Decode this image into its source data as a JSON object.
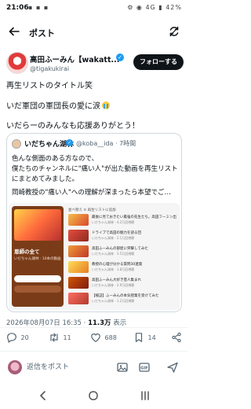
{
  "status_bar": {
    "time": "21:06",
    "left_icons": "▪ ▪ ▪",
    "right_icons": "⚙ ◉ 4G ▮ 42%"
  },
  "header": {
    "title": "ポスト"
  },
  "author": {
    "name": "高田ふーみん【wakatt...",
    "handle": "@tigakukirai",
    "follow_label": "フォローする"
  },
  "tweet": {
    "lines": [
      "再生リストのタイトル笑",
      "いだ軍団の軍団長の愛に涙",
      "いだらーのみんなも応援ありがとう！"
    ]
  },
  "quote": {
    "name": "いだちゃん湖林",
    "handle": "@koba__ida",
    "time": "· 7時間",
    "lines": [
      "色んな側面のある方なので、",
      "僕たちのチャンネルに\"痛い人\"が出た動画を再生リスト",
      "にまとめてみました。",
      "岡崎教授の\"痛い人\"への理解が深まったら本望でご…"
    ],
    "media": {
      "playlist_title": "恩師の全て",
      "playlist_owner": "いだちゃん湖林 · 10本の動画",
      "list_header": "並べ替え  ≡  再生リストに追加",
      "videos": [
        {
          "title": "最後に見ておきたい最強の先生たち。高田フーミン出演動画まとめ",
          "meta": "いだちゃん湖林 · 4.2万回視聴"
        },
        {
          "title": "ドライブで高田の魅力を語る回",
          "meta": "いだちゃん湖林 · 2.1万回視聴"
        },
        {
          "title": "高田ふーみんの部屋に突撃してみた",
          "meta": "いだちゃん湖林 · 3.5万回視聴"
        },
        {
          "title": "教授の心理が分かる質問30連発",
          "meta": "いだちゃん湖林 · 1.8万回視聴"
        },
        {
          "title": "高田ふーみん大好き芸人集まれ",
          "meta": "いだちゃん湖林 · 2.9万回視聴"
        },
        {
          "title": "【検証】ふーみんの本気授業を受けてみた",
          "meta": "いだちゃん湖林 · 1.2万回視聴"
        }
      ]
    }
  },
  "meta": {
    "datetime": "2026年08月07日 16:35 · ",
    "views": "11.3万",
    "views_suffix": " 表示"
  },
  "actions": {
    "replies": "20",
    "reposts": "11",
    "likes": "688",
    "bookmarks": "14"
  },
  "reply": {
    "placeholder": "返信をポスト"
  },
  "colors": {
    "accent": "#1d9bf0",
    "text": "#0f1419",
    "secondary": "#536471",
    "follow_bg": "#0f1419"
  }
}
